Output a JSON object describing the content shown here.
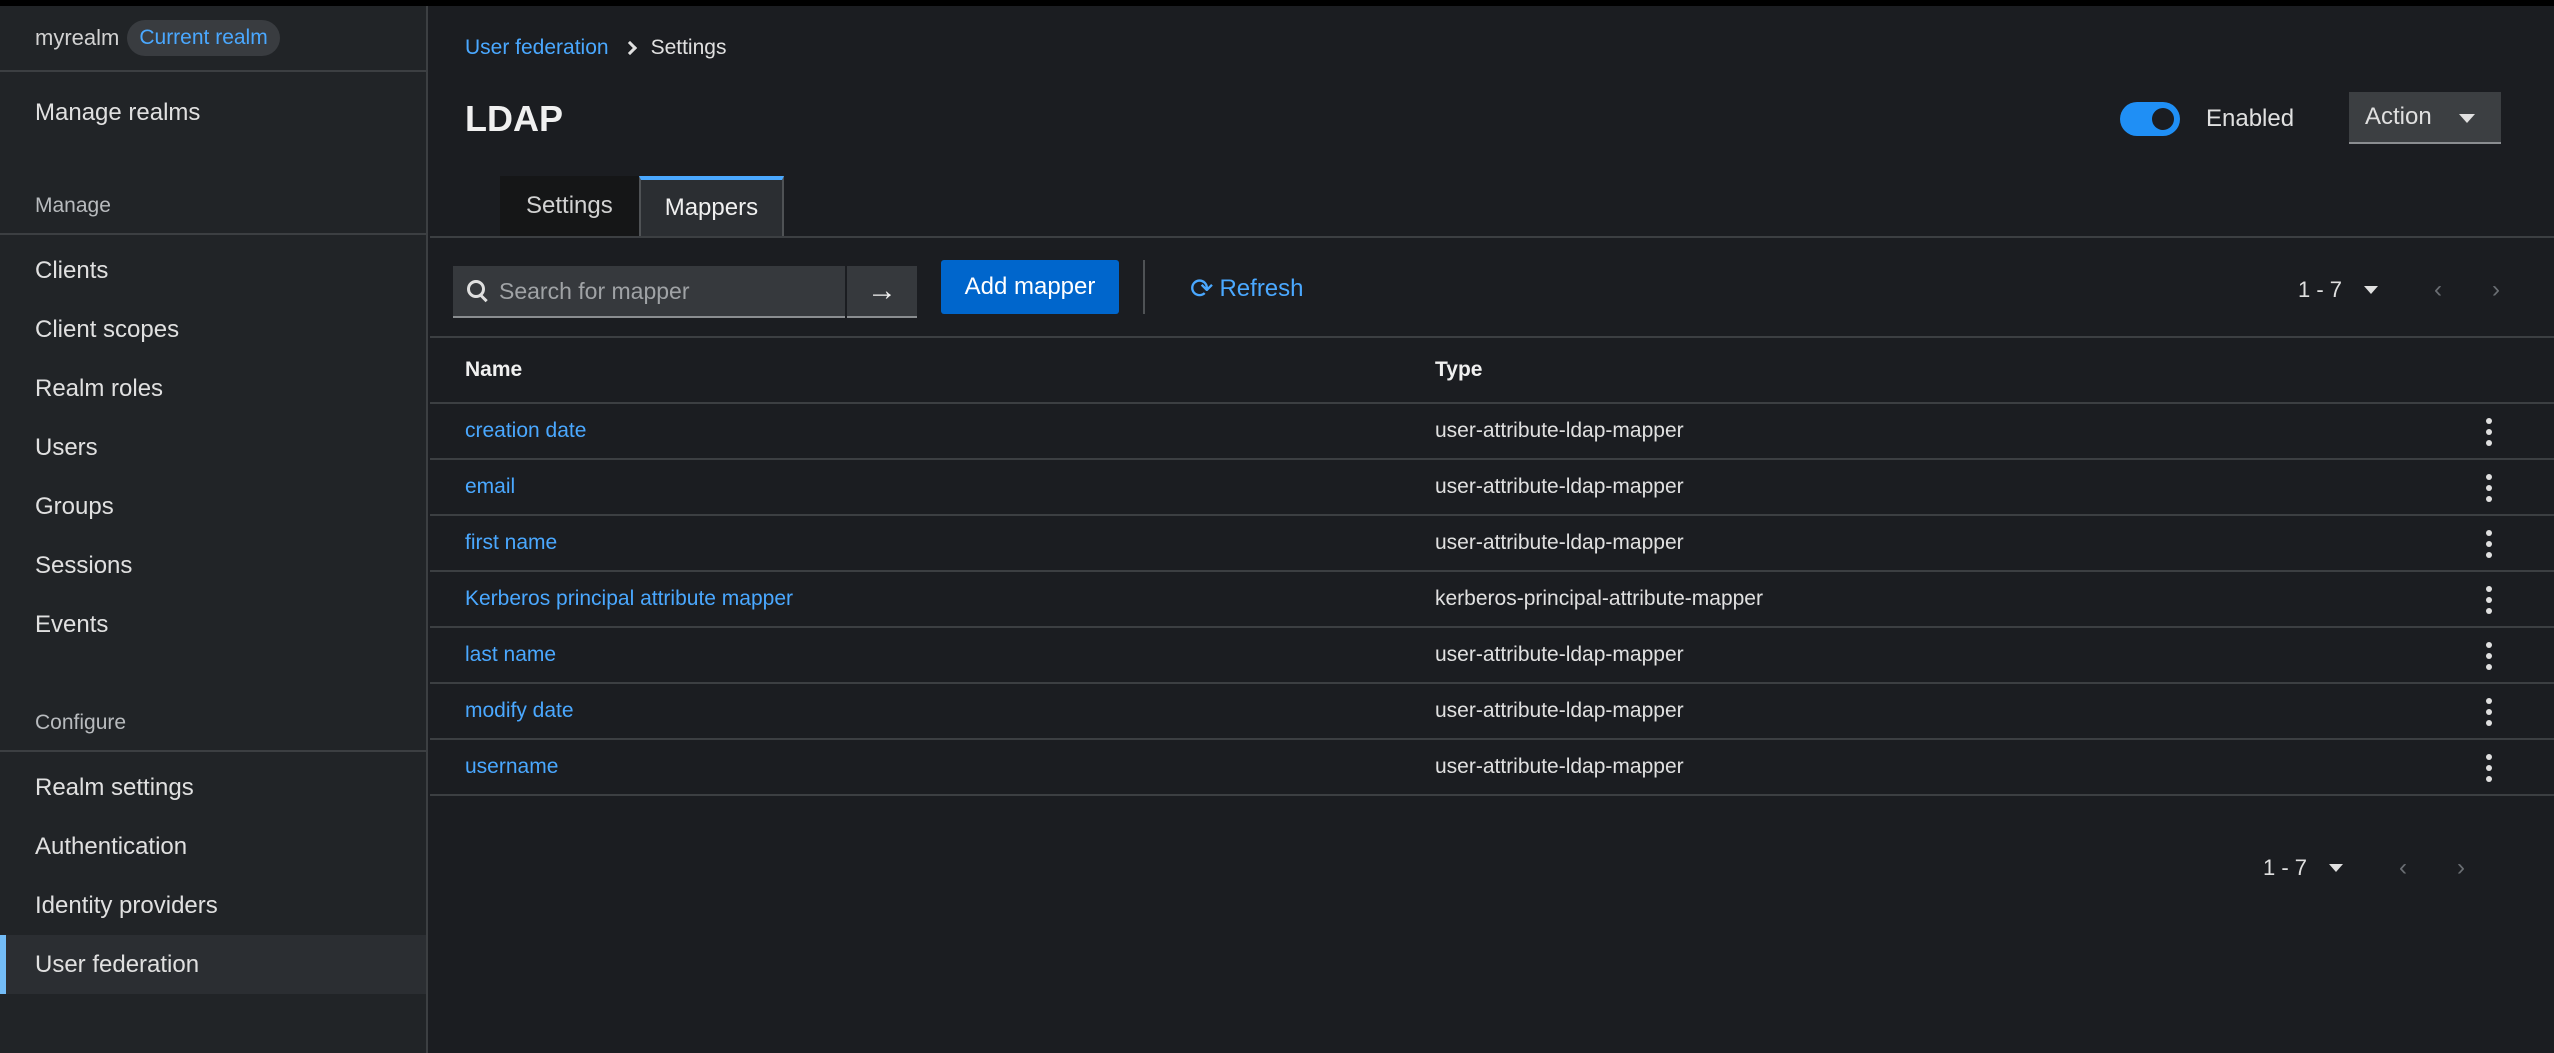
{
  "sidebar": {
    "realm_name": "myrealm",
    "realm_badge": "Current realm",
    "manage_realms": "Manage realms",
    "sections": {
      "manage": "Manage",
      "configure": "Configure"
    },
    "manage_items": [
      "Clients",
      "Client scopes",
      "Realm roles",
      "Users",
      "Groups",
      "Sessions",
      "Events"
    ],
    "configure_items": [
      "Realm settings",
      "Authentication",
      "Identity providers",
      "User federation"
    ]
  },
  "breadcrumb": {
    "parent": "User federation",
    "current": "Settings"
  },
  "page": {
    "title": "LDAP",
    "enabled_label": "Enabled",
    "action_label": "Action"
  },
  "tabs": [
    "Settings",
    "Mappers"
  ],
  "toolbar": {
    "search_placeholder": "Search for mapper",
    "add_label": "Add mapper",
    "refresh_label": "Refresh",
    "pagination": "1 - 7"
  },
  "table": {
    "headers": {
      "name": "Name",
      "type": "Type"
    },
    "rows": [
      {
        "name": "creation date",
        "type": "user-attribute-ldap-mapper"
      },
      {
        "name": "email",
        "type": "user-attribute-ldap-mapper"
      },
      {
        "name": "first name",
        "type": "user-attribute-ldap-mapper"
      },
      {
        "name": "Kerberos principal attribute mapper",
        "type": "kerberos-principal-attribute-mapper"
      },
      {
        "name": "last name",
        "type": "user-attribute-ldap-mapper"
      },
      {
        "name": "modify date",
        "type": "user-attribute-ldap-mapper"
      },
      {
        "name": "username",
        "type": "user-attribute-ldap-mapper"
      }
    ]
  },
  "footer": {
    "pagination": "1 - 7"
  },
  "colors": {
    "accent": "#4aa8ff",
    "primary_button": "#0066cc",
    "toggle_on": "#1f8ff5",
    "background": "#1b1d21"
  }
}
